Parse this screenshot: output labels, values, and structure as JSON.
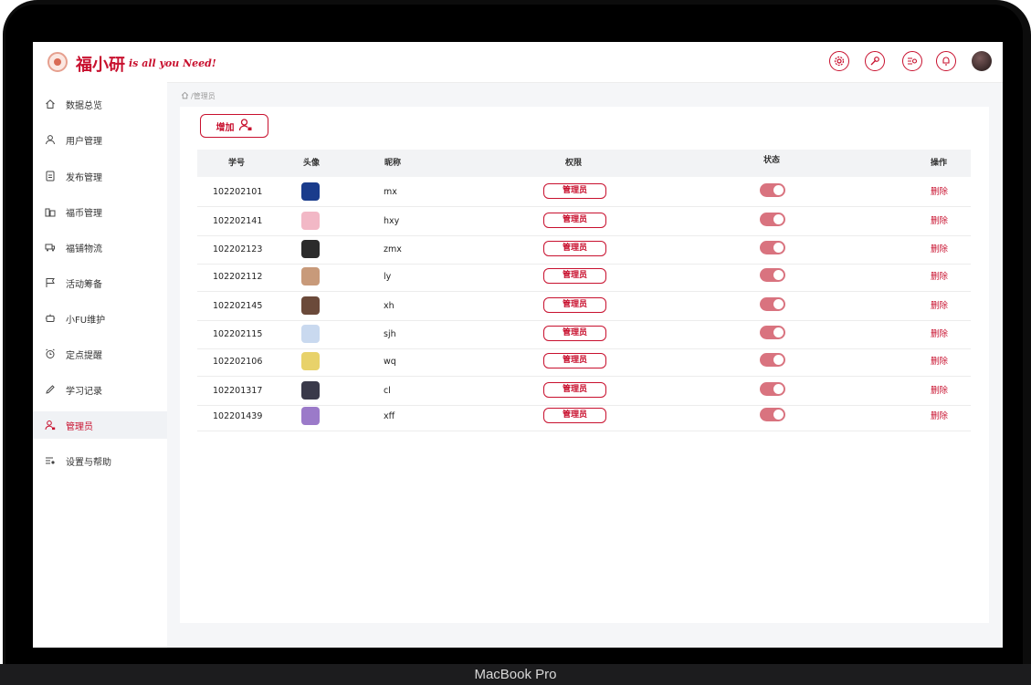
{
  "brand": {
    "name": "福小研",
    "slogan": "is all you Need!"
  },
  "header_icons": [
    "settings-icon",
    "wrench-icon",
    "search-list-icon",
    "bell-icon"
  ],
  "sidebar": {
    "items": [
      {
        "label": "数据总览",
        "icon": "home-icon"
      },
      {
        "label": "用户管理",
        "icon": "user-icon"
      },
      {
        "label": "发布管理",
        "icon": "document-icon"
      },
      {
        "label": "福币管理",
        "icon": "coins-icon"
      },
      {
        "label": "福铺物流",
        "icon": "truck-icon"
      },
      {
        "label": "活动筹备",
        "icon": "flag-icon"
      },
      {
        "label": "小FU维护",
        "icon": "robot-icon"
      },
      {
        "label": "定点提醒",
        "icon": "alarm-icon"
      },
      {
        "label": "学习记录",
        "icon": "pencil-icon"
      },
      {
        "label": "管理员",
        "icon": "admin-icon",
        "active": true
      },
      {
        "label": "设置与帮助",
        "icon": "settings-list-icon"
      }
    ]
  },
  "breadcrumb": {
    "path": "/管理员"
  },
  "toolbar": {
    "add_label": "增加"
  },
  "table": {
    "headers": {
      "id": "学号",
      "avatar": "头像",
      "nickname": "昵称",
      "permission": "权限",
      "status": "状态",
      "action": "操作"
    },
    "rows": [
      {
        "id": "102202101",
        "nickname": "mx",
        "permission": "管理员",
        "status": "on",
        "action": "删除",
        "avatar_color": "#1a3c8c"
      },
      {
        "id": "102202141",
        "nickname": "hxy",
        "permission": "管理员",
        "status": "on",
        "action": "删除",
        "avatar_color": "#f2b8c6"
      },
      {
        "id": "102202123",
        "nickname": "zmx",
        "permission": "管理员",
        "status": "on",
        "action": "删除",
        "avatar_color": "#2b2b2b"
      },
      {
        "id": "102202112",
        "nickname": "ly",
        "permission": "管理员",
        "status": "on",
        "action": "删除",
        "avatar_color": "#c89a7a"
      },
      {
        "id": "102202145",
        "nickname": "xh",
        "permission": "管理员",
        "status": "on",
        "action": "删除",
        "avatar_color": "#6b4a3a"
      },
      {
        "id": "102202115",
        "nickname": "sjh",
        "permission": "管理员",
        "status": "on",
        "action": "删除",
        "avatar_color": "#c9d9ef"
      },
      {
        "id": "102202106",
        "nickname": "wq",
        "permission": "管理员",
        "status": "on",
        "action": "删除",
        "avatar_color": "#e8d26a"
      },
      {
        "id": "102201317",
        "nickname": "cl",
        "permission": "管理员",
        "status": "on",
        "action": "删除",
        "avatar_color": "#3a3a4a"
      },
      {
        "id": "102201439",
        "nickname": "xff",
        "permission": "管理员",
        "status": "on",
        "action": "删除",
        "avatar_color": "#9b7ac9"
      }
    ]
  },
  "device": {
    "label": "MacBook Pro"
  },
  "colors": {
    "accent": "#c8102e",
    "toggle": "#d9737f"
  }
}
